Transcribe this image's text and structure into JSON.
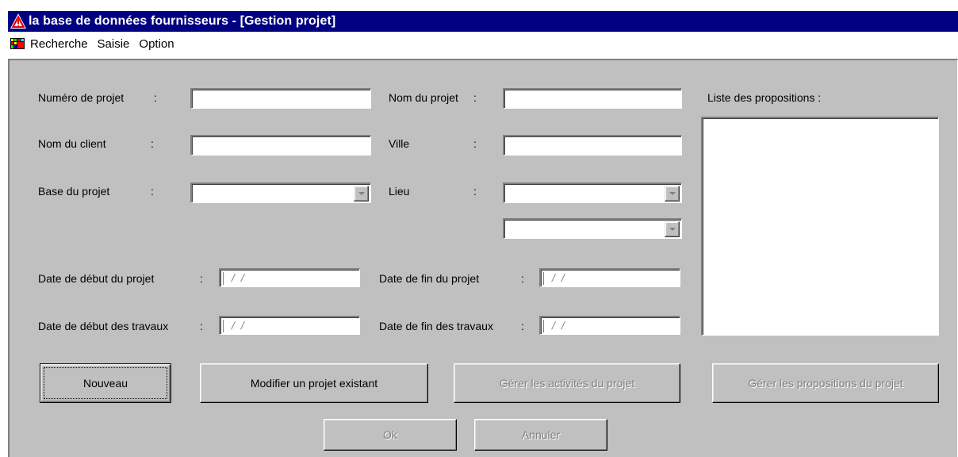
{
  "window": {
    "title": "la base de données fournisseurs - [Gestion projet]",
    "app_icon": "warning-triangle-icon"
  },
  "menu": {
    "icon": "app-menu-icon",
    "items": [
      "Recherche",
      "Saisie",
      "Option"
    ]
  },
  "form": {
    "numero_projet": {
      "label": "Numéro de projet",
      "colon": ":",
      "value": ""
    },
    "nom_client": {
      "label": "Nom du client",
      "colon": ":",
      "value": ""
    },
    "base_projet": {
      "label": "Base du projet",
      "colon": ":",
      "value": ""
    },
    "nom_projet": {
      "label": "Nom du projet",
      "colon": ":",
      "value": ""
    },
    "ville": {
      "label": "Ville",
      "colon": ":",
      "value": ""
    },
    "lieu": {
      "label": "Lieu",
      "colon": ":",
      "value": "",
      "value2": ""
    },
    "date_debut_projet": {
      "label": "Date de début du projet",
      "colon": ":",
      "value": "/ /"
    },
    "date_debut_travaux": {
      "label": "Date de début des travaux",
      "colon": ":",
      "value": "/ /"
    },
    "date_fin_projet": {
      "label": "Date de fin du projet",
      "colon": ":",
      "value": "/ /"
    },
    "date_fin_travaux": {
      "label": "Date de fin des travaux",
      "colon": ":",
      "value": "/ /"
    },
    "propositions": {
      "label": "Liste des propositions :",
      "items": []
    }
  },
  "buttons": {
    "nouveau": "Nouveau",
    "modifier": "Modifier un projet existant",
    "activites": "Gérer les activités du projet",
    "propositions": "Gérer les propositions du projet",
    "ok": "Ok",
    "annuler": "Annuler"
  },
  "colors": {
    "titlebar": "#000080",
    "face": "#c0c0c0",
    "disabled_text": "#808080"
  }
}
